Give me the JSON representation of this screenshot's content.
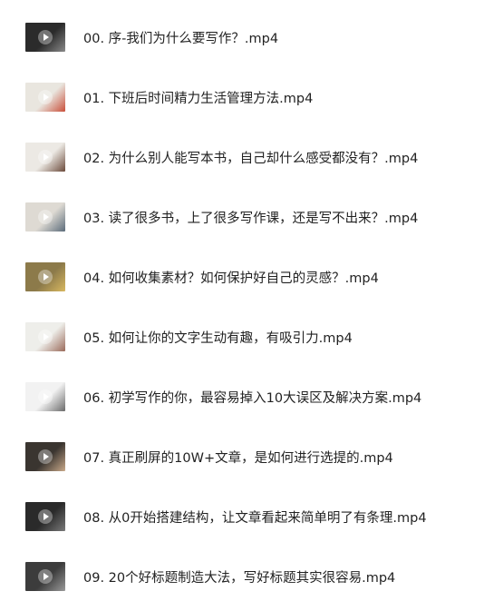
{
  "files": [
    {
      "name": "00. 序-我们为什么要写作？.mp4",
      "thumb_icon": "video-thumbnail-icon",
      "bg": "#2b2b2b",
      "accent": "#8a8a8a"
    },
    {
      "name": "01. 下班后时间精力生活管理方法.mp4",
      "thumb_icon": "video-thumbnail-icon",
      "bg": "#e9e6df",
      "accent": "#c94f3a"
    },
    {
      "name": "02. 为什么别人能写本书，自己却什么感受都没有？.mp4",
      "thumb_icon": "video-thumbnail-icon",
      "bg": "#ece9e4",
      "accent": "#6b4a3a"
    },
    {
      "name": "03. 读了很多书，上了很多写作课，还是写不出来？.mp4",
      "thumb_icon": "video-thumbnail-icon",
      "bg": "#dedad3",
      "accent": "#5b6b7a"
    },
    {
      "name": "04. 如何收集素材？如何保护好自己的灵感？.mp4",
      "thumb_icon": "video-thumbnail-icon",
      "bg": "#8c7a4a",
      "accent": "#d8b860"
    },
    {
      "name": "05. 如何让你的文字生动有趣，有吸引力.mp4",
      "thumb_icon": "video-thumbnail-icon",
      "bg": "#eeeeea",
      "accent": "#9a6a5a"
    },
    {
      "name": "06. 初学写作的你，最容易掉入10大误区及解决方案.mp4",
      "thumb_icon": "video-thumbnail-icon",
      "bg": "#f2f2f2",
      "accent": "#6a6a6a"
    },
    {
      "name": "07. 真正刷屏的10W+文章，是如何进行选提的.mp4",
      "thumb_icon": "video-thumbnail-icon",
      "bg": "#3a3530",
      "accent": "#c9a98a"
    },
    {
      "name": "08. 从0开始搭建结构，让文章看起来简单明了有条理.mp4",
      "thumb_icon": "video-thumbnail-icon",
      "bg": "#2a2a2a",
      "accent": "#7a7a7a"
    },
    {
      "name": "09. 20个好标题制造大法，写好标题其实很容易.mp4",
      "thumb_icon": "video-thumbnail-icon",
      "bg": "#3c3c3c",
      "accent": "#9a9a9a"
    }
  ]
}
